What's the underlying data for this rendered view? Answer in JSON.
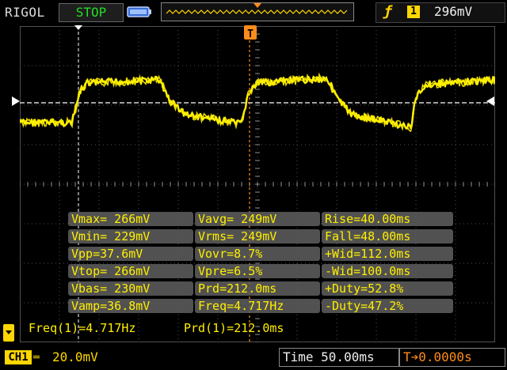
{
  "header": {
    "brand": "RIGOL",
    "run_state": "STOP",
    "trigger_edge_icon": "rising-edge-icon",
    "trigger_channel": "1",
    "trigger_level": "296mV"
  },
  "markers": {
    "trigger_marker": "T"
  },
  "measurements": {
    "rows": [
      [
        "Vmax= 266mV",
        "Vavg= 249mV",
        "Rise=40.00ms"
      ],
      [
        "Vmin= 229mV",
        "Vrms= 249mV",
        "Fall=48.00ms"
      ],
      [
        "Vpp=37.6mV",
        "Vovr=8.7%",
        "+Wid=112.0ms"
      ],
      [
        "Vtop= 266mV",
        "Vpre=6.5%",
        "-Wid=100.0ms"
      ],
      [
        "Vbas= 230mV",
        "Prd=212.0ms",
        "+Duty=52.8%"
      ],
      [
        "Vamp=36.8mV",
        "Freq=4.717Hz",
        "-Duty=47.2%"
      ]
    ]
  },
  "readouts": {
    "freq": "Freq(1)=4.717Hz",
    "prd": "Prd(1)=212.0ms"
  },
  "footer": {
    "channel": "CH1",
    "channel_scale": "20.0mV",
    "timebase": "Time 50.00ms",
    "trigger_offset": "0.0000s"
  },
  "colors": {
    "trace": "#ffef00",
    "trigger": "#ff8c1a",
    "run_state": "#22dd22",
    "grid": "#505050"
  }
}
